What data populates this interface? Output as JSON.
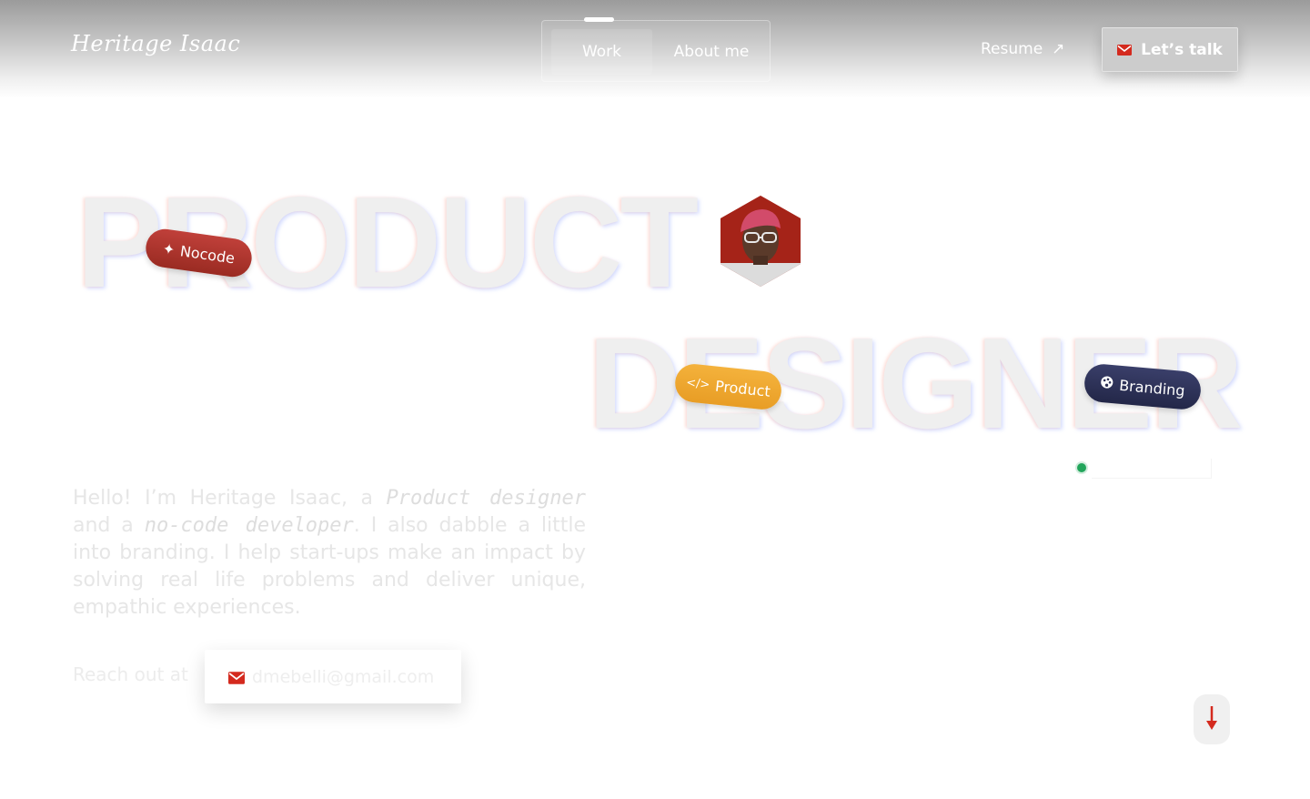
{
  "header": {
    "logo_text": "Heritage Isaac",
    "nav_tabs": [
      {
        "label": "Work",
        "active": true
      },
      {
        "label": "About me",
        "active": false
      }
    ],
    "resume_label": "Resume",
    "resume_arrow": "↗",
    "cta_label": "Let’s talk",
    "cta_icon": "mail-icon"
  },
  "hero": {
    "word_1": "PRODUCT",
    "word_2": "DESIGNER",
    "tags": [
      {
        "label": "Nocode",
        "icon": "sparkle-icon",
        "color": "#a8322a"
      },
      {
        "label": "Product",
        "icon": "code-icon",
        "color": "#f0a830"
      },
      {
        "label": "Branding",
        "icon": "palette-icon",
        "color": "#2c3055"
      }
    ],
    "status_color": "#22a55b"
  },
  "intro": {
    "text_1": "Hello! I’m Heritage Isaac, a ",
    "em_1": "Product designer",
    "text_2": " and a ",
    "em_2": "no-code developer",
    "text_3": ". I also dabble a little into branding. I help start-ups make an impact by solving real life problems and deliver unique, empathic experiences."
  },
  "contact": {
    "reach_label": "Reach out at",
    "email": "dmebelli@gmail.com"
  },
  "colors": {
    "accent_red": "#d42a1e"
  }
}
